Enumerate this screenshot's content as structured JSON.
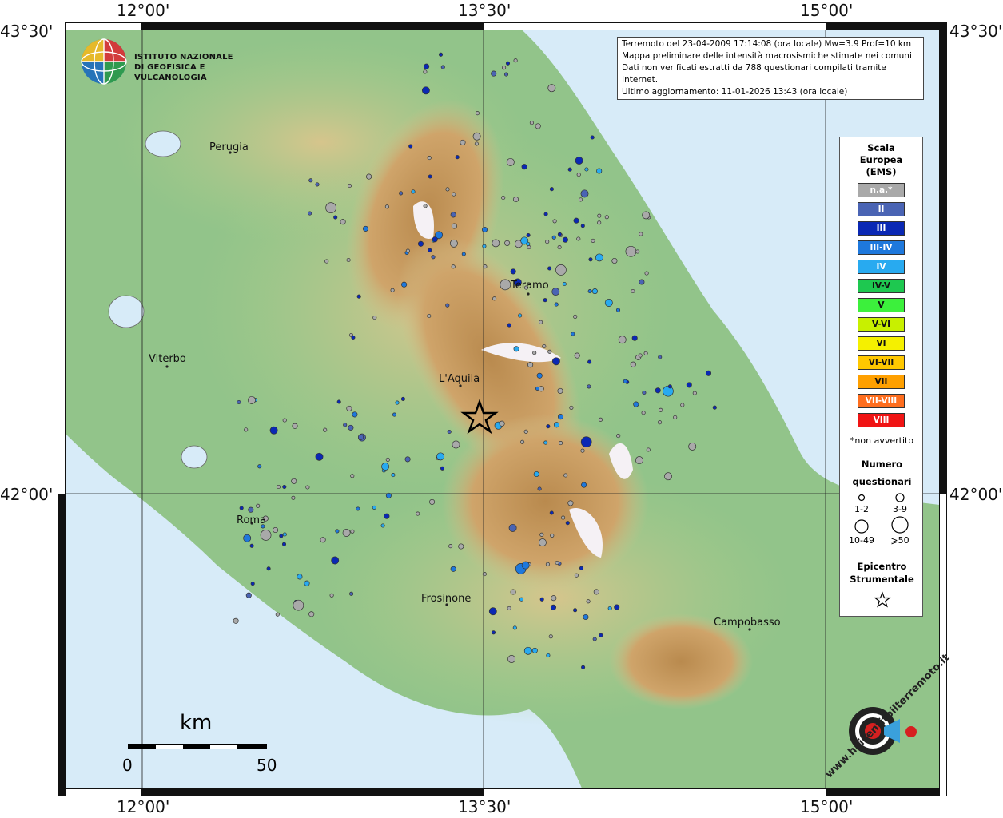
{
  "header": {
    "institute_line1": "ISTITUTO NAZIONALE",
    "institute_line2": "DI GEOFISICA E VULCANOLOGIA"
  },
  "info": {
    "line1": "Terremoto del 23-04-2009 17:14:08 (ora locale) Mw=3.9 Prof=10 km",
    "line2": "Mappa preliminare delle intensità macrosismiche stimate nei comuni",
    "line3": "Dati non verificati estratti da 788 questionari compilati tramite Internet.",
    "line4": "Ultimo aggiornamento: 11-01-2026 13:43 (ora locale)"
  },
  "coords": {
    "top": [
      "12°00'",
      "13°30'",
      "15°00'"
    ],
    "bottom": [
      "12°00'",
      "13°30'",
      "15°00'"
    ],
    "left": [
      "43°30'",
      "42°00'"
    ],
    "right": [
      "43°30'",
      "42°00'"
    ]
  },
  "cities": [
    {
      "name": "Perugia"
    },
    {
      "name": "Teramo"
    },
    {
      "name": "Viterbo"
    },
    {
      "name": "L'Aquila"
    },
    {
      "name": "Roma"
    },
    {
      "name": "Frosinone"
    },
    {
      "name": "Campobasso"
    }
  ],
  "legend": {
    "title1": "Scala",
    "title2": "Europea",
    "title3": "(EMS)",
    "ems": [
      {
        "label": "n.a.*",
        "color": "#a9a9a9"
      },
      {
        "label": "II",
        "color": "#4a64b4"
      },
      {
        "label": "III",
        "color": "#0a28b4"
      },
      {
        "label": "III-IV",
        "color": "#1e78dc"
      },
      {
        "label": "IV",
        "color": "#28aaf0"
      },
      {
        "label": "IV-V",
        "color": "#1ec850"
      },
      {
        "label": "V",
        "color": "#3cf03c"
      },
      {
        "label": "V-VI",
        "color": "#c8f000"
      },
      {
        "label": "VI",
        "color": "#f5f000"
      },
      {
        "label": "VI-VII",
        "color": "#ffc800"
      },
      {
        "label": "VII",
        "color": "#ffa000"
      },
      {
        "label": "VII-VIII",
        "color": "#ff6e1e"
      },
      {
        "label": "VIII",
        "color": "#f01414"
      }
    ],
    "not_felt": "*non avvertito",
    "count_title1": "Numero",
    "count_title2": "questionari",
    "counts": [
      "1-2",
      "3-9",
      "10-49",
      "⩾50"
    ],
    "epi_title1": "Epicentro",
    "epi_title2": "Strumentale"
  },
  "scale_bar": {
    "unit": "km",
    "min": "0",
    "max": "50"
  },
  "colors": {
    "sea": "#d8ecf8",
    "lowland": "#8fc488",
    "hills": "#c9c48a",
    "mountains": "#c89a5a",
    "peaks": "#f4f0f4"
  },
  "watermark": {
    "text": "www.haisentitoilterremoto.it"
  }
}
